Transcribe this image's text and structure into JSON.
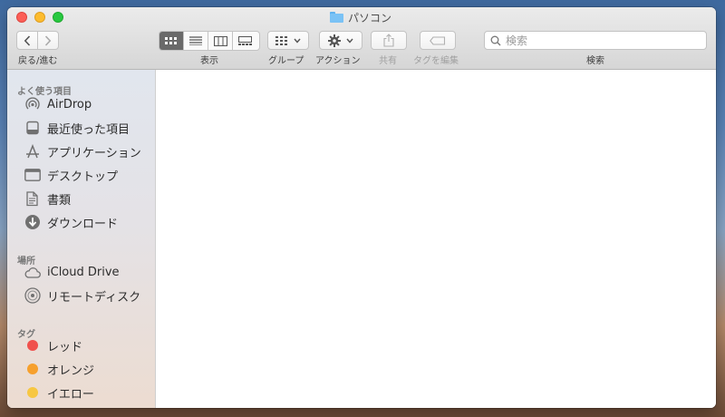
{
  "window": {
    "title": "パソコン"
  },
  "toolbar": {
    "back_forward_label": "戻る/進む",
    "view_label": "表示",
    "group_label": "グループ",
    "action_label": "アクション",
    "share_label": "共有",
    "tag_edit_label": "タグを編集",
    "search_label": "検索"
  },
  "search": {
    "placeholder": "検索"
  },
  "sidebar": {
    "favorites": {
      "header": "よく使う項目",
      "items": [
        {
          "label": "AirDrop",
          "icon": "airdrop-icon"
        },
        {
          "label": "最近使った項目",
          "icon": "recents-icon"
        },
        {
          "label": "アプリケーション",
          "icon": "applications-icon"
        },
        {
          "label": "デスクトップ",
          "icon": "desktop-icon"
        },
        {
          "label": "書類",
          "icon": "documents-icon"
        },
        {
          "label": "ダウンロード",
          "icon": "downloads-icon"
        }
      ]
    },
    "locations": {
      "header": "場所",
      "items": [
        {
          "label": "iCloud Drive",
          "icon": "icloud-icon"
        },
        {
          "label": "リモートディスク",
          "icon": "remote-disc-icon"
        }
      ]
    },
    "tags": {
      "header": "タグ",
      "items": [
        {
          "label": "レッド",
          "color": "#f0514d"
        },
        {
          "label": "オレンジ",
          "color": "#f6a02d"
        },
        {
          "label": "イエロー",
          "color": "#f7c742"
        }
      ]
    }
  },
  "colors": {
    "selected_view": "#6a6a6a",
    "folder": "#7ac2f5"
  }
}
